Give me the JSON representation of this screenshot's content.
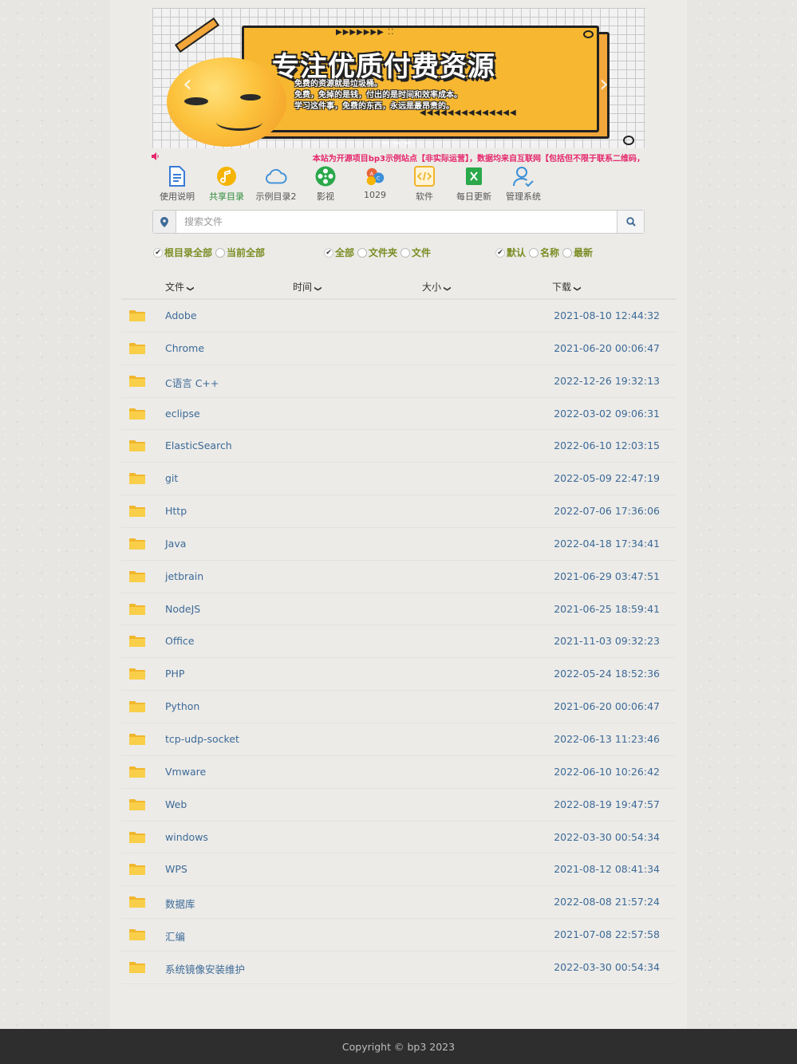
{
  "banner": {
    "title": "专注优质付费资源",
    "line1": "免费的资源就是垃圾桶。",
    "line2": "免费，免掉的是钱，付出的是时间和效率成本。",
    "line3": "学习这件事，免费的东西，永远是最昂贵的。",
    "prev_arrow": "‹",
    "next_arrow": "›"
  },
  "notice": {
    "icon": "speaker-icon",
    "text": "本站为开源项目bp3示例站点【非实际运营】，数据均来自互联网【包括但不限于联系二维码，"
  },
  "nav": [
    {
      "label": "使用说明",
      "icon": "document-icon",
      "color": "#3a7bd5"
    },
    {
      "label": "共享目录",
      "icon": "music-note-icon",
      "color": "#f5b400"
    },
    {
      "label": "示例目录2",
      "icon": "cloud-icon",
      "color": "#3a8fd6"
    },
    {
      "label": "影视",
      "icon": "film-reel-icon",
      "color": "#2aa84a"
    },
    {
      "label": "1029",
      "icon": "abc-blocks-icon",
      "color": "#e8643b"
    },
    {
      "label": "软件",
      "icon": "code-icon",
      "color": "#f0b429"
    },
    {
      "label": "每日更新",
      "icon": "excel-icon",
      "color": "#2aa84a"
    },
    {
      "label": "管理系统",
      "icon": "user-check-icon",
      "color": "#3a8fd6"
    }
  ],
  "search": {
    "placeholder": "搜索文件",
    "value": ""
  },
  "filters": {
    "scope": [
      {
        "label": "根目录全部",
        "checked": true
      },
      {
        "label": "当前全部",
        "checked": false
      }
    ],
    "type": [
      {
        "label": "全部",
        "checked": true
      },
      {
        "label": "文件夹",
        "checked": false
      },
      {
        "label": "文件",
        "checked": false
      }
    ],
    "sort": [
      {
        "label": "默认",
        "checked": true
      },
      {
        "label": "名称",
        "checked": false
      },
      {
        "label": "最新",
        "checked": false
      }
    ]
  },
  "table": {
    "columns": {
      "file": "文件",
      "time": "时间",
      "size": "大小",
      "download": "下载"
    },
    "rows": [
      {
        "name": "Adobe",
        "date": "2021-08-10 12:44:32"
      },
      {
        "name": "Chrome",
        "date": "2021-06-20 00:06:47"
      },
      {
        "name": "C语言 C++",
        "date": "2022-12-26 19:32:13"
      },
      {
        "name": "eclipse",
        "date": "2022-03-02 09:06:31"
      },
      {
        "name": "ElasticSearch",
        "date": "2022-06-10 12:03:15"
      },
      {
        "name": "git",
        "date": "2022-05-09 22:47:19"
      },
      {
        "name": "Http",
        "date": "2022-07-06 17:36:06"
      },
      {
        "name": "Java",
        "date": "2022-04-18 17:34:41"
      },
      {
        "name": "jetbrain",
        "date": "2021-06-29 03:47:51"
      },
      {
        "name": "NodeJS",
        "date": "2021-06-25 18:59:41"
      },
      {
        "name": "Office",
        "date": "2021-11-03 09:32:23"
      },
      {
        "name": "PHP",
        "date": "2022-05-24 18:52:36"
      },
      {
        "name": "Python",
        "date": "2021-06-20 00:06:47"
      },
      {
        "name": "tcp-udp-socket",
        "date": "2022-06-13 11:23:46"
      },
      {
        "name": "Vmware",
        "date": "2022-06-10 10:26:42"
      },
      {
        "name": "Web",
        "date": "2022-08-19 19:47:57"
      },
      {
        "name": "windows",
        "date": "2022-03-30 00:54:34"
      },
      {
        "name": "WPS",
        "date": "2021-08-12 08:41:34"
      },
      {
        "name": "数据库",
        "date": "2022-08-08 21:57:24"
      },
      {
        "name": "汇编",
        "date": "2021-07-08 22:57:58"
      },
      {
        "name": "系统镜像安装维护",
        "date": "2022-03-30 00:54:34"
      }
    ]
  },
  "footer": {
    "copyright": "Copyright © bp3 2023"
  },
  "colors": {
    "link": "#3d6a97",
    "accent_green": "#7a8d24",
    "notice_pink": "#e5266b",
    "folder_yellow": "#f7c43a",
    "footer_bg": "#2e2e2e"
  }
}
